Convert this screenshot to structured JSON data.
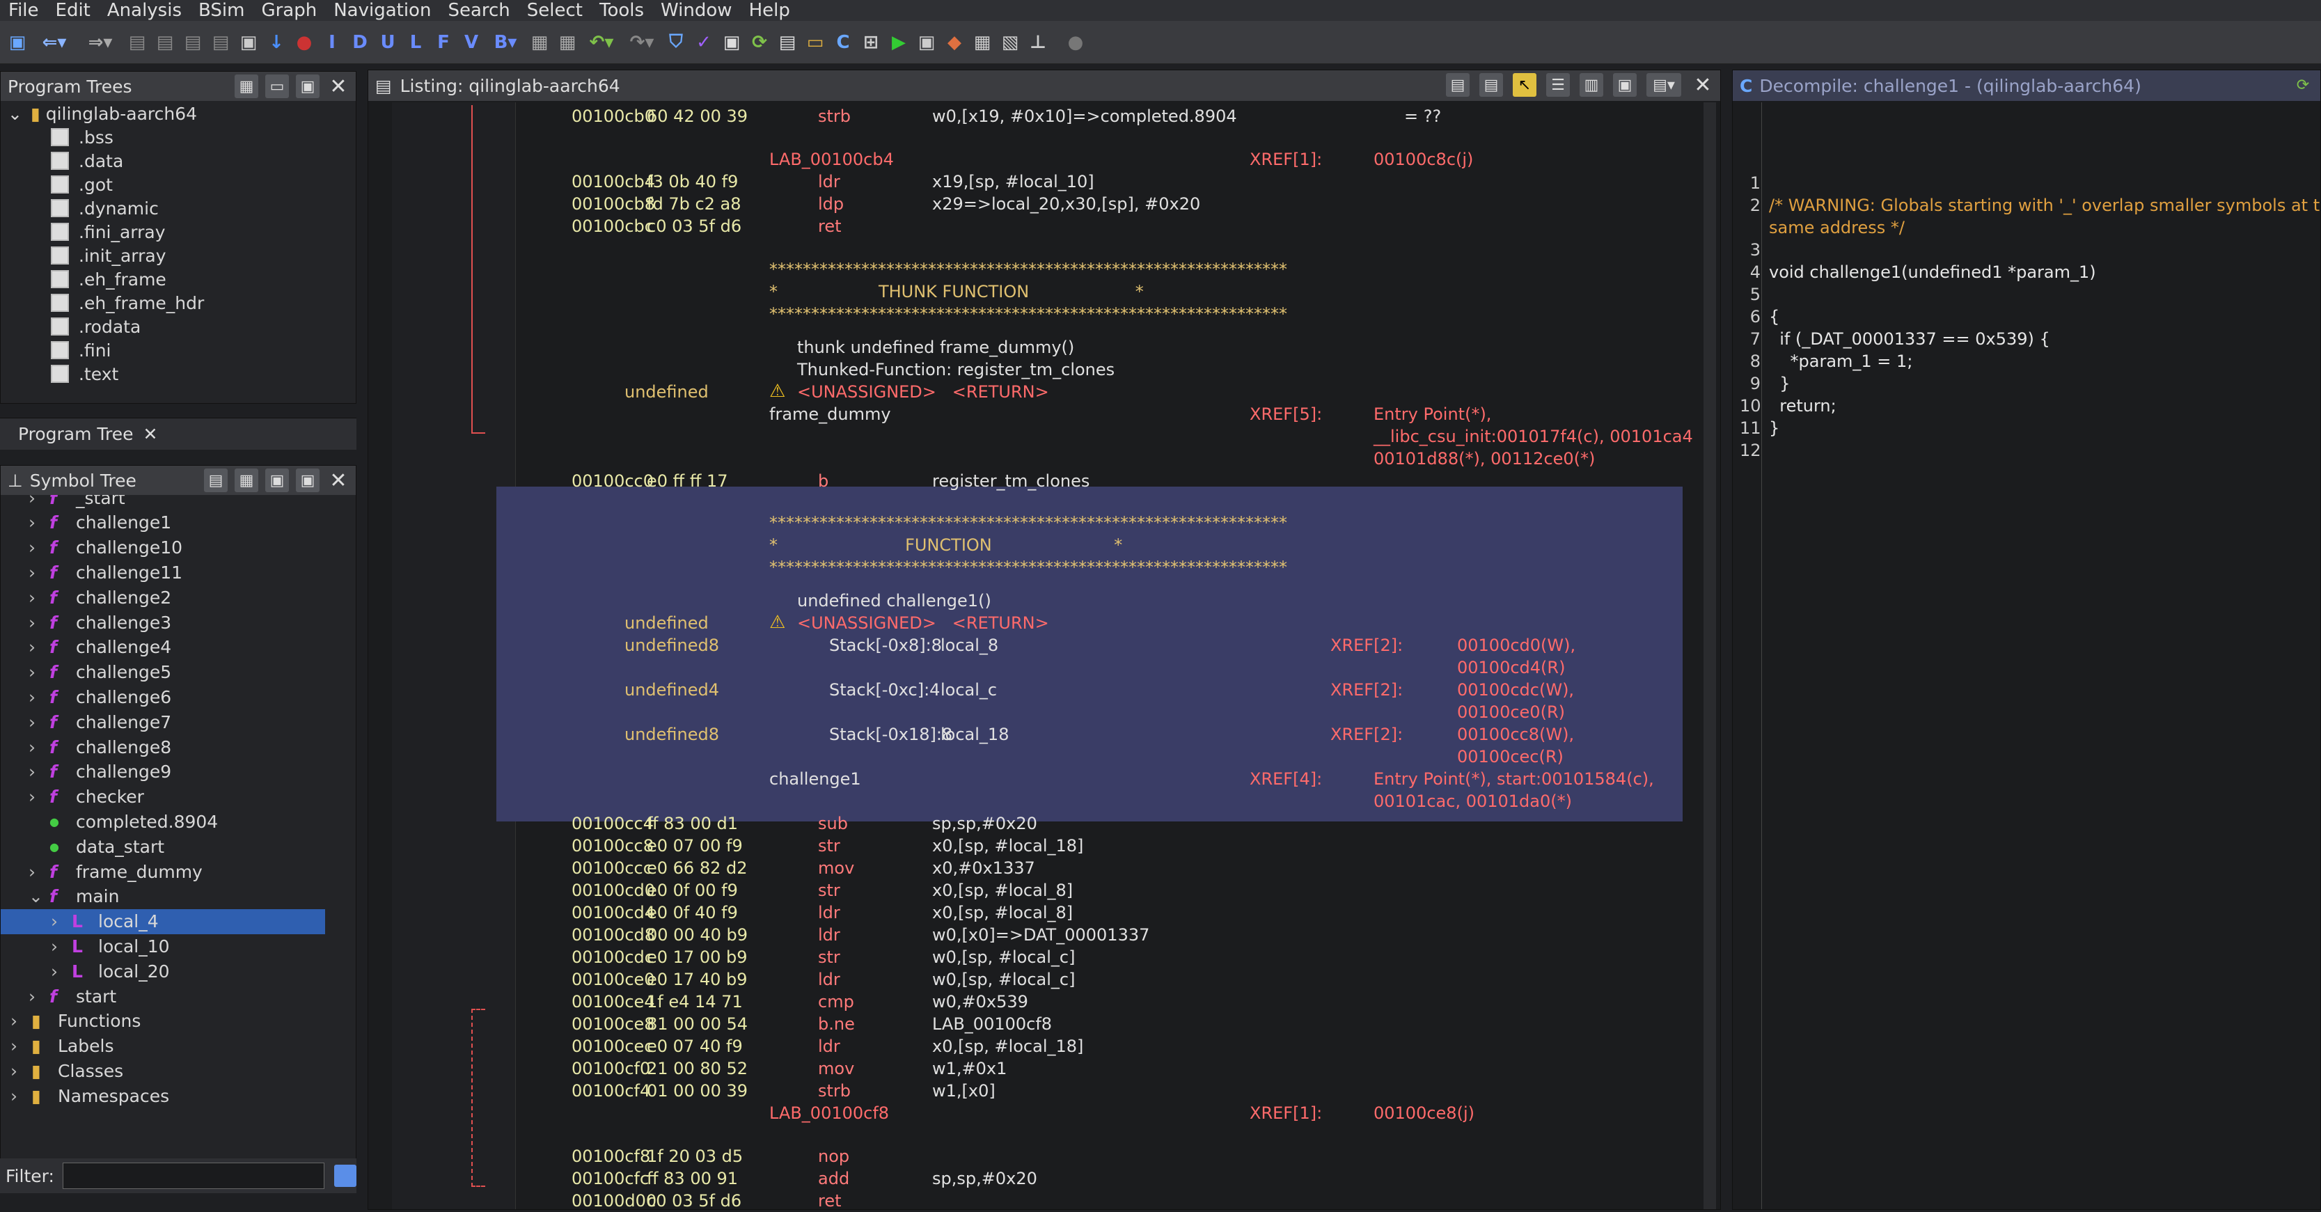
{
  "menu": [
    "File",
    "Edit",
    "Analysis",
    "BSim",
    "Graph",
    "Navigation",
    "Search",
    "Select",
    "Tools",
    "Window",
    "Help"
  ],
  "program_trees": {
    "title": "Program Trees",
    "root": "qilinglab-aarch64",
    "items": [
      ".bss",
      ".data",
      ".got",
      ".dynamic",
      ".fini_array",
      ".init_array",
      ".eh_frame",
      ".eh_frame_hdr",
      ".rodata",
      ".fini",
      ".text"
    ],
    "tab": "Program Tree"
  },
  "symbol_tree": {
    "title": "Symbol Tree",
    "items": [
      "_start",
      "challenge1",
      "challenge10",
      "challenge11",
      "challenge2",
      "challenge3",
      "challenge4",
      "challenge5",
      "challenge6",
      "challenge7",
      "challenge8",
      "challenge9",
      "checker",
      "completed.8904",
      "data_start",
      "frame_dummy",
      "main",
      "local_4",
      "local_10",
      "local_20",
      "start",
      "Functions",
      "Labels",
      "Classes",
      "Namespaces"
    ],
    "filter_label": "Filter:"
  },
  "listing": {
    "title": "Listing:  qilinglab-aarch64"
  },
  "decompile": {
    "title": "Decompile: challenge1 -  (qilinglab-aarch64)",
    "lines": [
      "",
      "/* WARNING: Globals starting with '_' overlap smaller symbols at the",
      "same address */",
      "",
      "void challenge1(undefined1 *param_1)",
      "",
      "{",
      "  if (_DAT_00001337 == 0x539) {",
      "    *param_1 = 1;",
      "  }",
      "  return;",
      "}",
      ""
    ],
    "numbers": [
      "1",
      "2",
      "",
      "3",
      "4",
      "5",
      "6",
      "7",
      "8",
      "9",
      "10",
      "11",
      "12"
    ]
  },
  "code": [
    {
      "a": "00100cb0",
      "b": "60 42 00 39",
      "m": "strb",
      "o": "w0,[x19, #0x10]=>completed.8904",
      "x": "= ??"
    },
    {
      "l": "LAB_00100cb4",
      "xr": "XREF[1]:",
      "xv": "00100c8c(j)"
    },
    {
      "a": "00100cb4",
      "b": "f3 0b 40 f9",
      "m": "ldr",
      "o": "x19,[sp, #local_10]"
    },
    {
      "a": "00100cb8",
      "b": "fd 7b c2 a8",
      "m": "ldp",
      "o": "x29=>local_20,x30,[sp], #0x20"
    },
    {
      "a": "00100cbc",
      "b": "c0 03 5f d6",
      "m": "ret",
      "o": ""
    },
    {
      "s": "**************************************************************"
    },
    {
      "s": "*                   THUNK FUNCTION                    *"
    },
    {
      "s": "**************************************************************"
    },
    {
      "t": "thunk undefined frame_dummy()"
    },
    {
      "t": "Thunked-Function: register_tm_clones"
    },
    {
      "u": "undefined",
      "v": "<UNASSIGNED>   <RETURN>"
    },
    {
      "l": "frame_dummy",
      "xr": "XREF[5]:",
      "xv": "Entry Point(*),"
    },
    {
      "xv2": "__libc_csu_init:001017f4(c), 00101ca4"
    },
    {
      "xv2": "00101d88(*), 00112ce0(*)"
    },
    {
      "a": "00100cc0",
      "b": "e0 ff ff 17",
      "m": "b",
      "o": "register_tm_clones"
    },
    {
      "s": "**************************************************************"
    },
    {
      "s": "*                        FUNCTION                       *"
    },
    {
      "s": "**************************************************************"
    },
    {
      "t": "undefined challenge1()"
    },
    {
      "u": "undefined",
      "v": "<UNASSIGNED>   <RETURN>"
    },
    {
      "u": "undefined8",
      "st": "Stack[-0x8]:8",
      "sn": "local_8",
      "xr": "XREF[2]:",
      "xv": "00100cd0(W),"
    },
    {
      "xv3": "00100cd4(R)"
    },
    {
      "u": "undefined4",
      "st": "Stack[-0xc]:4",
      "sn": "local_c",
      "xr": "XREF[2]:",
      "xv": "00100cdc(W),"
    },
    {
      "xv3": "00100ce0(R)"
    },
    {
      "u": "undefined8",
      "st": "Stack[-0x18]:8",
      "sn": "local_18",
      "xr": "XREF[2]:",
      "xv": "00100cc8(W),"
    },
    {
      "xv3": "00100cec(R)"
    },
    {
      "l": "challenge1",
      "xr": "XREF[4]:",
      "xv": "Entry Point(*), start:00101584(c),"
    },
    {
      "xv2": "00101cac, 00101da0(*)"
    },
    {
      "a": "00100cc4",
      "b": "ff 83 00 d1",
      "m": "sub",
      "o": "sp,sp,#0x20"
    },
    {
      "a": "00100cc8",
      "b": "e0 07 00 f9",
      "m": "str",
      "o": "x0,[sp, #local_18]"
    },
    {
      "a": "00100ccc",
      "b": "e0 66 82 d2",
      "m": "mov",
      "o": "x0,#0x1337"
    },
    {
      "a": "00100cd0",
      "b": "e0 0f 00 f9",
      "m": "str",
      "o": "x0,[sp, #local_8]"
    },
    {
      "a": "00100cd4",
      "b": "e0 0f 40 f9",
      "m": "ldr",
      "o": "x0,[sp, #local_8]"
    },
    {
      "a": "00100cd8",
      "b": "00 00 40 b9",
      "m": "ldr",
      "o": "w0,[x0]=>DAT_00001337"
    },
    {
      "a": "00100cdc",
      "b": "e0 17 00 b9",
      "m": "str",
      "o": "w0,[sp, #local_c]"
    },
    {
      "a": "00100ce0",
      "b": "e0 17 40 b9",
      "m": "ldr",
      "o": "w0,[sp, #local_c]"
    },
    {
      "a": "00100ce4",
      "b": "1f e4 14 71",
      "m": "cmp",
      "o": "w0,#0x539"
    },
    {
      "a": "00100ce8",
      "b": "81 00 00 54",
      "m": "b.ne",
      "o": "LAB_00100cf8"
    },
    {
      "a": "00100cec",
      "b": "e0 07 40 f9",
      "m": "ldr",
      "o": "x0,[sp, #local_18]"
    },
    {
      "a": "00100cf0",
      "b": "21 00 80 52",
      "m": "mov",
      "o": "w1,#0x1"
    },
    {
      "a": "00100cf4",
      "b": "01 00 00 39",
      "m": "strb",
      "o": "w1,[x0]"
    },
    {
      "l": "LAB_00100cf8",
      "xr": "XREF[1]:",
      "xv": "00100ce8(j)"
    },
    {
      "a": "00100cf8",
      "b": "1f 20 03 d5",
      "m": "nop",
      "o": ""
    },
    {
      "a": "00100cfc",
      "b": "ff 83 00 91",
      "m": "add",
      "o": "sp,sp,#0x20"
    },
    {
      "a": "00100d00",
      "b": "c0 03 5f d6",
      "m": "ret",
      "o": ""
    }
  ]
}
